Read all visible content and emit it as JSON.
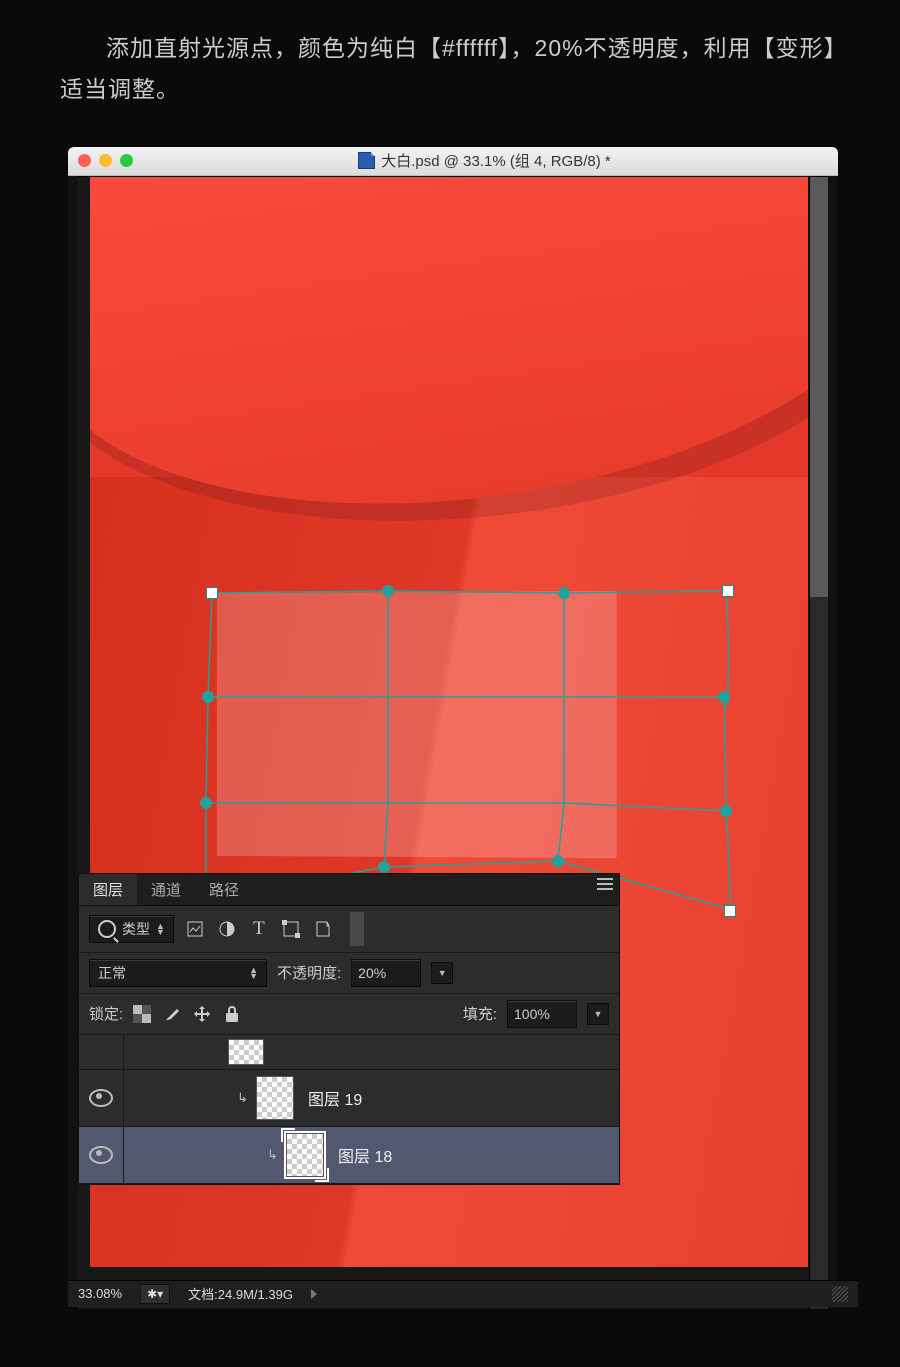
{
  "caption": "添加直射光源点，颜色为纯白【#ffffff】，20%不透明度，利用【变形】适当调整。",
  "window": {
    "title": "大白.psd @ 33.1% (组 4, RGB/8) *"
  },
  "panel": {
    "tabs": {
      "layers": "图层",
      "channels": "通道",
      "paths": "路径"
    },
    "kind_label": "类型",
    "blend_mode": "正常",
    "opacity_label": "不透明度:",
    "opacity_value": "20%",
    "lock_label": "锁定:",
    "fill_label": "填充:",
    "fill_value": "100%",
    "layers": [
      {
        "name": ""
      },
      {
        "name": "图层 19"
      },
      {
        "name": "图层 18"
      }
    ]
  },
  "status": {
    "zoom": "33.08%",
    "doc": "文档:24.9M/1.39G"
  }
}
